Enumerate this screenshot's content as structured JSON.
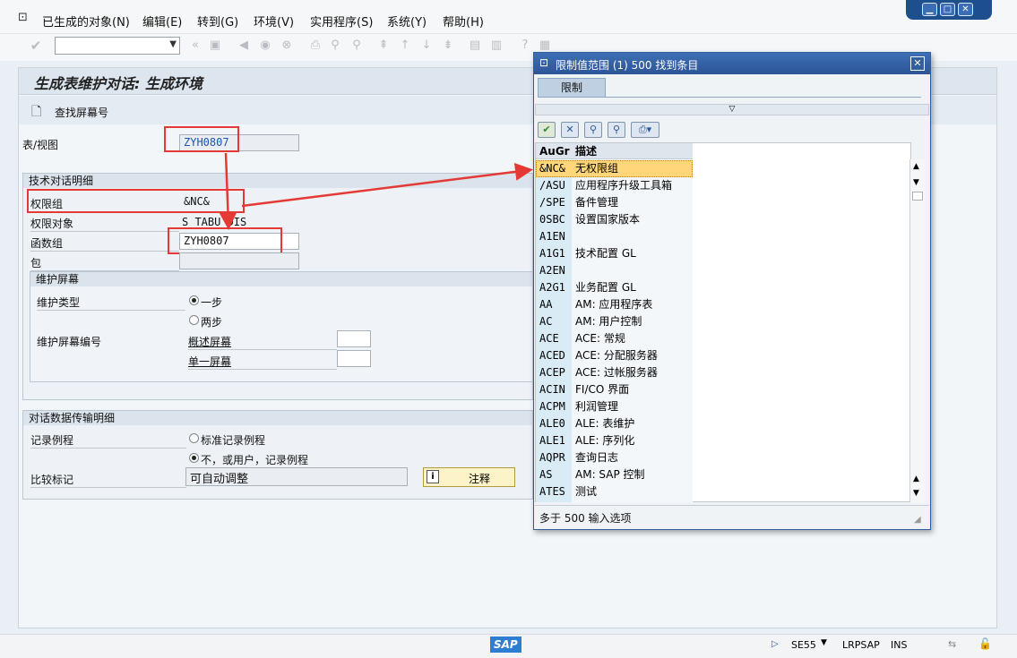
{
  "menu": {
    "items": [
      "已生成的对象(N)",
      "编辑(E)",
      "转到(G)",
      "环境(V)",
      "实用程序(S)",
      "系统(Y)",
      "帮助(H)"
    ]
  },
  "window_controls": {
    "minimize": "▁",
    "maximize": "□",
    "close": "✕"
  },
  "page": {
    "title": "生成表维护对话: 生成环境",
    "find_screen": "查找屏幕号"
  },
  "form": {
    "table_view_label": "表/视图",
    "table_view_value": "ZYH0807",
    "tech_group_title": "技术对话明细",
    "auth_group_label": "权限组",
    "auth_group_value": "&NC&",
    "auth_object_label": "权限对象",
    "auth_object_value": "S_TABU_DIS",
    "function_group_label": "函数组",
    "function_group_value": "ZYH0807",
    "package_label": "包",
    "package_value": "",
    "maint_screen_title": "维护屏幕",
    "maint_type_label": "维护类型",
    "maint_type_one": "一步",
    "maint_type_two": "两步",
    "maint_screen_no_label": "维护屏幕编号",
    "overview_screen": "概述屏幕",
    "single_screen": "单一屏幕",
    "transport_title": "对话数据传输明细",
    "record_routine_label": "记录例程",
    "record_standard": "标准记录例程",
    "record_none": "不，或用户，记录例程",
    "compare_flag_label": "比较标记",
    "compare_flag_value": "可自动调整",
    "note_button": "注释"
  },
  "popup": {
    "title": "限制值范围 (1)  500 找到条目",
    "tab": "限制",
    "col_code": "AuGr",
    "col_desc": "描述",
    "rows": [
      {
        "code": "&NC&",
        "desc": "无权限组"
      },
      {
        "code": "/ASU",
        "desc": "应用程序升级工具箱"
      },
      {
        "code": "/SPE",
        "desc": "备件管理"
      },
      {
        "code": "0SBC",
        "desc": "设置国家版本"
      },
      {
        "code": "A1EN",
        "desc": ""
      },
      {
        "code": "A1G1",
        "desc": "技术配置 GL"
      },
      {
        "code": "A2EN",
        "desc": ""
      },
      {
        "code": "A2G1",
        "desc": "业务配置 GL"
      },
      {
        "code": "AA",
        "desc": "AM: 应用程序表"
      },
      {
        "code": "AC",
        "desc": "AM: 用户控制"
      },
      {
        "code": "ACE",
        "desc": "ACE: 常规"
      },
      {
        "code": "ACED",
        "desc": "ACE: 分配服务器"
      },
      {
        "code": "ACEP",
        "desc": "ACE: 过帐服务器"
      },
      {
        "code": "ACIN",
        "desc": "FI/CO 界面"
      },
      {
        "code": "ACPM",
        "desc": "利润管理"
      },
      {
        "code": "ALE0",
        "desc": "ALE: 表维护"
      },
      {
        "code": "ALE1",
        "desc": "ALE: 序列化"
      },
      {
        "code": "AQPR",
        "desc": "查询日志"
      },
      {
        "code": "AS",
        "desc": "AM: SAP 控制"
      },
      {
        "code": "ATES",
        "desc": "测试"
      }
    ],
    "footer": "多于 500 输入选项"
  },
  "status": {
    "logo": "SAP",
    "tcode": "SE55",
    "server": "LRPSAP",
    "mode": "INS"
  },
  "colors": {
    "accent": "#2c5597",
    "highlight": "#ffd77a",
    "annotation": "#e53935"
  }
}
